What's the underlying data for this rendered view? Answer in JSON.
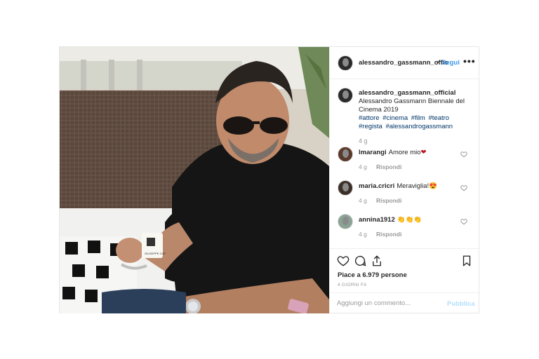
{
  "post": {
    "username": "alessandro_gassmann_offic",
    "dot": "•",
    "follow_label": "Segui",
    "more_label": "•••"
  },
  "caption": {
    "username": "alessandro_gassmann_official",
    "text": "Alessandro Gassmann Biennale del Cinema 2019",
    "hashtags": [
      "#attore",
      "#cinema",
      "#film",
      "#teatro",
      "#regista",
      "#alessandrogassmann"
    ],
    "time": "4 g"
  },
  "comments": [
    {
      "user": "lmarangi",
      "text": "Amore mio",
      "emoji": "❤",
      "time": "4 g",
      "reply": "Rispondi"
    },
    {
      "user": "maria.cricri",
      "text": "Meraviglia!",
      "emoji": "😍",
      "time": "4 g",
      "reply": "Rispondi"
    },
    {
      "user": "annina1912",
      "text": "👏👏👏",
      "emoji": "",
      "time": "4 g",
      "reply": "Rispondi"
    }
  ],
  "actions": {
    "likes_text": "Piace a 6.979 persone",
    "time_ago": "4 GIORNI FA",
    "comment_placeholder": "Aggiungi un commento...",
    "publish_label": "Pubblica"
  },
  "photo": {
    "cup_brand": "GIUSEPPE CUP"
  },
  "colors": {
    "link": "#3897f0",
    "hashtag": "#003569",
    "secondary": "#999999",
    "publish_disabled": "#b2dffc"
  }
}
